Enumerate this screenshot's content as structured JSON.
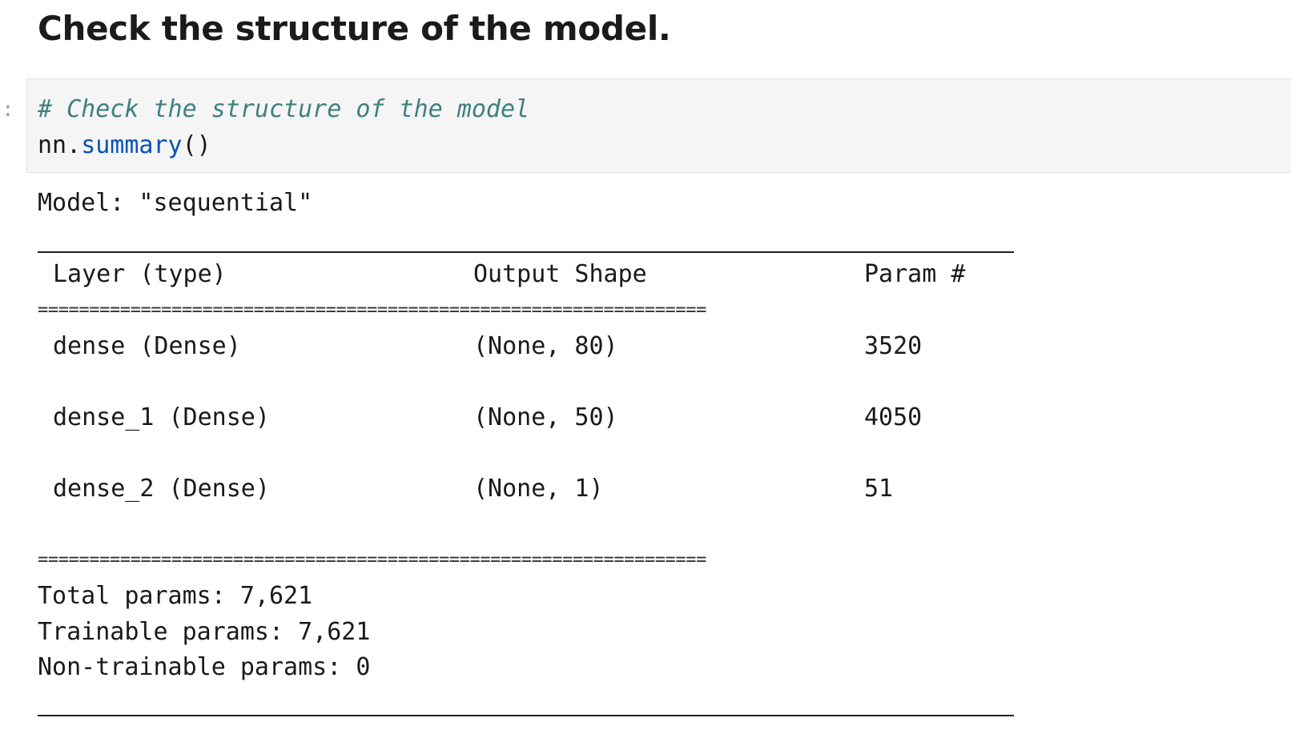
{
  "markdown": {
    "heading": "Check the structure of the model."
  },
  "cell": {
    "prompt": ":",
    "comment": "# Check the structure of the model",
    "code": {
      "object": "nn",
      "dot": ".",
      "method": "summary",
      "parens": "()"
    }
  },
  "output": {
    "model_line": "Model: \"sequential\"",
    "headers": {
      "layer": "Layer (type)",
      "shape": "Output Shape",
      "param": "Param #"
    },
    "separator_equals": "=================================================================",
    "rows": [
      {
        "layer": "dense (Dense)",
        "shape": "(None, 80)",
        "param": "3520"
      },
      {
        "layer": "dense_1 (Dense)",
        "shape": "(None, 50)",
        "param": "4050"
      },
      {
        "layer": "dense_2 (Dense)",
        "shape": "(None, 1)",
        "param": "51"
      }
    ],
    "total_params": "Total params: 7,621",
    "trainable_params": "Trainable params: 7,621",
    "non_trainable_params": "Non-trainable params: 0"
  }
}
